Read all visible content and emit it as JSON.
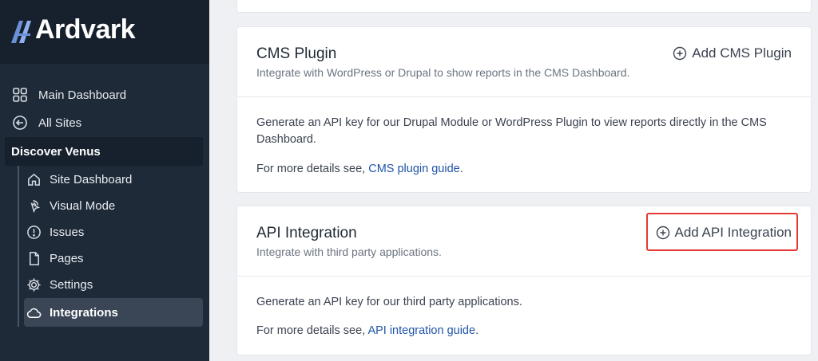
{
  "brand": {
    "name": "Ardvark",
    "mark": "A"
  },
  "sidebar": {
    "top_items": [
      {
        "label": "Main Dashboard",
        "icon": "grid-icon"
      },
      {
        "label": "All Sites",
        "icon": "arrow-left-circle-icon"
      }
    ],
    "site_name": "Discover Venus",
    "site_items": [
      {
        "label": "Site Dashboard",
        "icon": "home-icon"
      },
      {
        "label": "Visual Mode",
        "icon": "pointer-icon"
      },
      {
        "label": "Issues",
        "icon": "alert-circle-icon"
      },
      {
        "label": "Pages",
        "icon": "file-icon"
      },
      {
        "label": "Settings",
        "icon": "gear-icon"
      },
      {
        "label": "Integrations",
        "icon": "cloud-icon",
        "active": true
      }
    ]
  },
  "cms_card": {
    "title": "CMS Plugin",
    "subtitle": "Integrate with WordPress or Drupal to show reports in the CMS Dashboard.",
    "action": "Add CMS Plugin",
    "body": "Generate an API key for our Drupal Module or WordPress Plugin to view reports directly in the CMS Dashboard.",
    "details_prefix": "For more details see,",
    "details_link": "CMS plugin guide",
    "details_suffix": "."
  },
  "api_card": {
    "title": "API Integration",
    "subtitle": "Integrate with third party applications.",
    "action": "Add API Integration",
    "body": "Generate an API key for our third party applications.",
    "details_prefix": "For more details see,",
    "details_link": "API integration guide",
    "details_suffix": "."
  },
  "colors": {
    "sidebar_bg": "#1f2a38",
    "link": "#1f55a8",
    "highlight": "#e53935"
  }
}
